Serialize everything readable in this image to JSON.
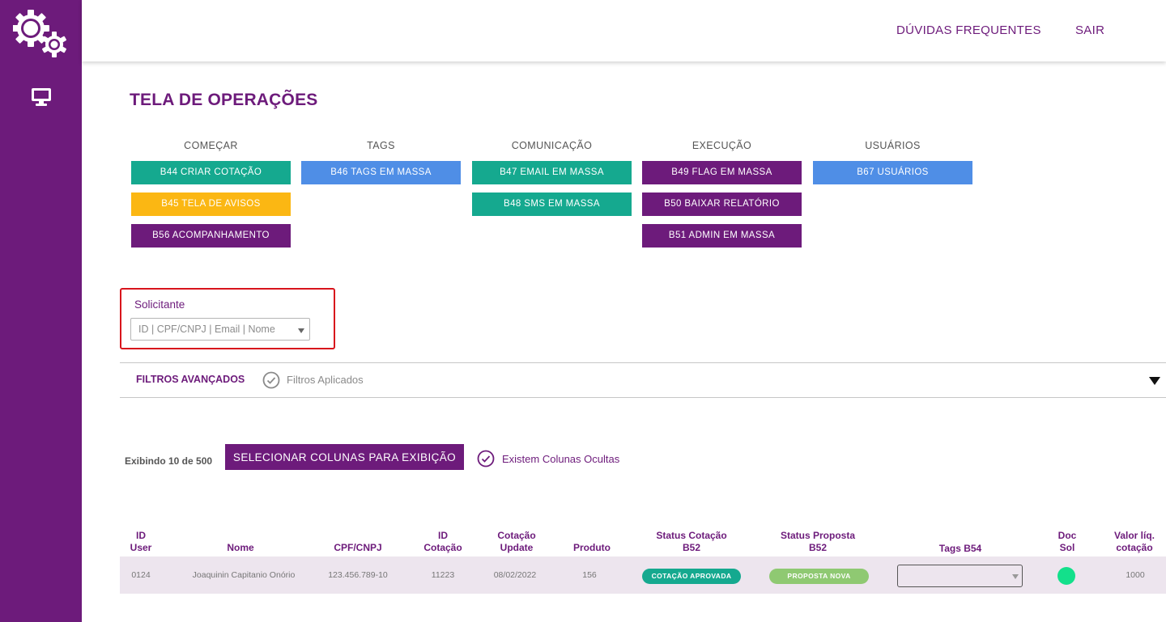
{
  "header": {
    "faq_label": "DÚVIDAS FREQUENTES",
    "exit_label": "SAIR"
  },
  "page": {
    "title": "TELA DE OPERAÇÕES"
  },
  "groups": [
    {
      "title": "COMEÇAR",
      "buttons": [
        "B44  CRIAR COTAÇÃO",
        "B45 TELA DE AVISOS",
        "B56 ACOMPANHAMENTO"
      ]
    },
    {
      "title": "TAGS",
      "buttons": [
        "B46 TAGS EM MASSA"
      ]
    },
    {
      "title": "COMUNICAÇÃO",
      "buttons": [
        "B47 EMAIL EM MASSA",
        "B48 SMS EM MASSA"
      ]
    },
    {
      "title": "EXECUÇÃO",
      "buttons": [
        "B49 FLAG EM MASSA",
        "B50 BAIXAR RELATÓRIO",
        "B51 ADMIN EM MASSA"
      ]
    },
    {
      "title": "USUÁRIOS",
      "buttons": [
        "B67 USUÁRIOS"
      ]
    }
  ],
  "requester": {
    "label": "Solicitante",
    "placeholder": "ID | CPF/CNPJ | Email | Nome"
  },
  "filters": {
    "title": "FILTROS AVANÇADOS",
    "applied_label": "Filtros Aplicados"
  },
  "table_controls": {
    "showing": "Exibindo 10 de 500",
    "select_columns_label": "SELECIONAR COLUNAS PARA EXIBIÇÃO",
    "hidden_columns_label": "Existem Colunas Ocultas"
  },
  "table": {
    "headers": {
      "id_user": [
        "ID",
        "User"
      ],
      "name": "Nome",
      "cpf": "CPF/CNPJ",
      "id_quote": [
        "ID",
        "Cotação"
      ],
      "quote_update": [
        "Cotação",
        "Update"
      ],
      "product": "Produto",
      "status_quote": [
        "Status Cotação",
        "B52"
      ],
      "status_proposal": [
        "Status Proposta",
        "B52"
      ],
      "tags": "Tags B54",
      "doc": [
        "Doc",
        "Sol"
      ],
      "net_value": [
        "Valor líq.",
        "cotação"
      ]
    },
    "rows": [
      {
        "id_user": "0124",
        "name": "Joaquinin Capitanio Onório",
        "cpf": "123.456.789-10",
        "id_quote": "11223",
        "quote_update": "08/02/2022",
        "product": "156",
        "status_quote": "COTAÇÃO APROVADA",
        "status_proposal": "PROPOSTA NOVA",
        "tags": "",
        "doc_status": "ok",
        "net_value": "1000"
      }
    ]
  },
  "colors": {
    "brand_purple": "#6d1b7b",
    "green": "#15a98f",
    "blue": "#4f8ee6",
    "yellow": "#fbb713",
    "proposal_green": "#8fc972",
    "doc_dot": "#13e08b",
    "highlight_border": "#d8141c"
  },
  "icons": {
    "logo": "gears-icon",
    "nav": "monitor-icon",
    "check": "check-circle-icon",
    "toggle": "caret-down-icon"
  }
}
